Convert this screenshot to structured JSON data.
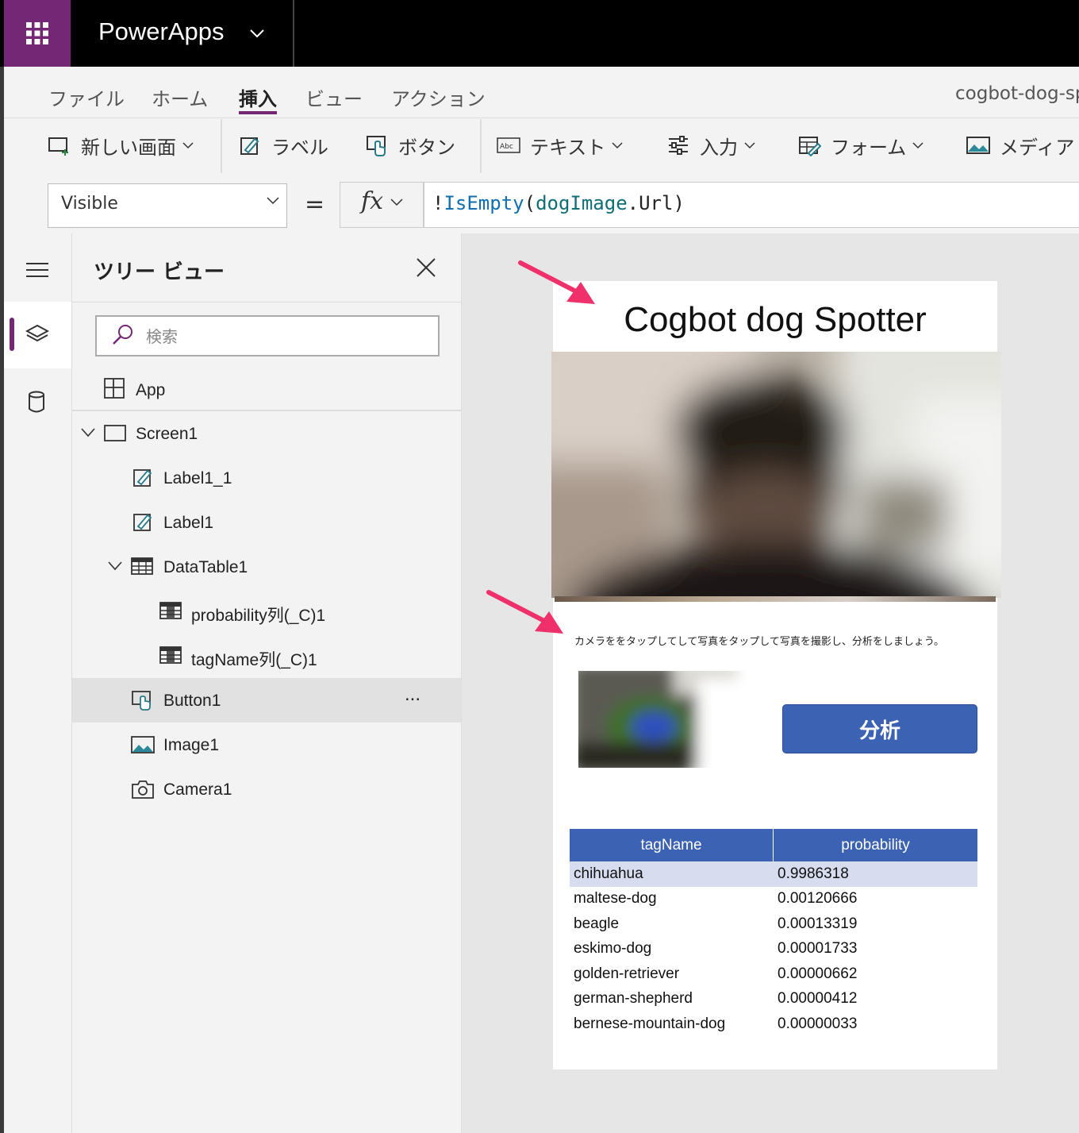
{
  "app": {
    "name": "PowerApps",
    "project_name": "cogbot-dog-sp"
  },
  "menu": {
    "items": [
      "ファイル",
      "ホーム",
      "挿入",
      "ビュー",
      "アクション"
    ],
    "active": "挿入"
  },
  "ribbon": {
    "new_screen": "新しい画面",
    "label": "ラベル",
    "button": "ボタン",
    "text": "テキスト",
    "input": "入力",
    "form": "フォーム",
    "media": "メディア"
  },
  "formula_bar": {
    "property": "Visible",
    "equals": "=",
    "fx": "fx",
    "formula_prefix": "!",
    "formula_fn": "IsEmpty",
    "formula_open": "(",
    "formula_id": "dogImage",
    "formula_rest": ".Url)"
  },
  "tree_view": {
    "title": "ツリー ビュー",
    "search_placeholder": "検索",
    "items": [
      {
        "label": "App",
        "icon": "app-icon"
      },
      {
        "label": "Screen1",
        "icon": "screen-icon"
      },
      {
        "label": "Label1_1",
        "icon": "label-edit-icon"
      },
      {
        "label": "Label1",
        "icon": "label-edit-icon"
      },
      {
        "label": "DataTable1",
        "icon": "datatable-icon"
      },
      {
        "label": "probability列(_C)1",
        "icon": "column-icon"
      },
      {
        "label": "tagName列(_C)1",
        "icon": "column-icon"
      },
      {
        "label": "Button1",
        "icon": "button-icon"
      },
      {
        "label": "Image1",
        "icon": "image-icon"
      },
      {
        "label": "Camera1",
        "icon": "camera-icon"
      }
    ],
    "selected": "Button1",
    "more": "..."
  },
  "canvas": {
    "title": "Cogbot dog Spotter",
    "instruction": "カメラををタップしてして写真をタップして写真を撮影し、分析をしましょう。",
    "analyze_button": "分析",
    "table": {
      "headers": [
        "tagName",
        "probability"
      ],
      "rows": [
        [
          "chihuahua",
          "0.9986318"
        ],
        [
          "maltese-dog",
          "0.00120666"
        ],
        [
          "beagle",
          "0.00013319"
        ],
        [
          "eskimo-dog",
          "0.00001733"
        ],
        [
          "golden-retriever",
          "0.00000662"
        ],
        [
          "german-shepherd",
          "0.00000412"
        ],
        [
          "bernese-mountain-dog",
          "0.00000033"
        ]
      ],
      "selected_row": 0
    }
  },
  "colors": {
    "brand": "#742774",
    "accent_blue": "#3b62b3",
    "annotation_arrow": "#f0306a"
  }
}
